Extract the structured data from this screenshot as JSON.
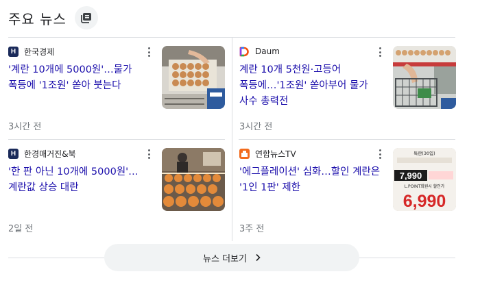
{
  "section": {
    "title": "주요 뉴스",
    "header_icon": "news-stack-icon"
  },
  "articles": [
    {
      "source": "한국경제",
      "logo_text": "H",
      "logo_color": "#1a2a5a",
      "headline": "'계란 10개에 5000원'…물가 폭등에 '1조원' 쏟아 붓는다",
      "time": "3시간 전",
      "thumb": "egg-tray-shopping-image"
    },
    {
      "source": "Daum",
      "logo_text": "D",
      "logo_color": "#f24f0f",
      "headline": "계란 10개 5천원·고등어 폭등에…'1조원' 쏟아부어 물가 사수 총력전",
      "time": "3시간 전",
      "thumb": "egg-cart-shopping-image"
    },
    {
      "source": "한경매거진&북",
      "logo_text": "H",
      "logo_color": "#1a2a5a",
      "headline": "'한 판 아닌 10개에 5000원'…계란값 상승 대란",
      "time": "2일 전",
      "thumb": "egg-shelf-image"
    },
    {
      "source": "연합뉴스TV",
      "logo_text": "",
      "logo_color": "#f26b1d",
      "headline": "'에그플레이션' 심화…할인 계란은 '1인 1판' 제한",
      "time": "3주 전",
      "thumb": "egg-price-tag-image",
      "thumb_text": {
        "line1": "특란(30입)",
        "line2": "7,990",
        "line3": "L.POINT회원시 할인가",
        "price": "6,990"
      }
    }
  ],
  "more_button": {
    "label": "뉴스 더보기",
    "icon": "chevron-right-icon"
  },
  "colors": {
    "headline": "#1a0dab",
    "meta": "#70757a",
    "divider": "#dadce0",
    "button_bg": "#f1f3f4",
    "price_red": "#d62828"
  }
}
